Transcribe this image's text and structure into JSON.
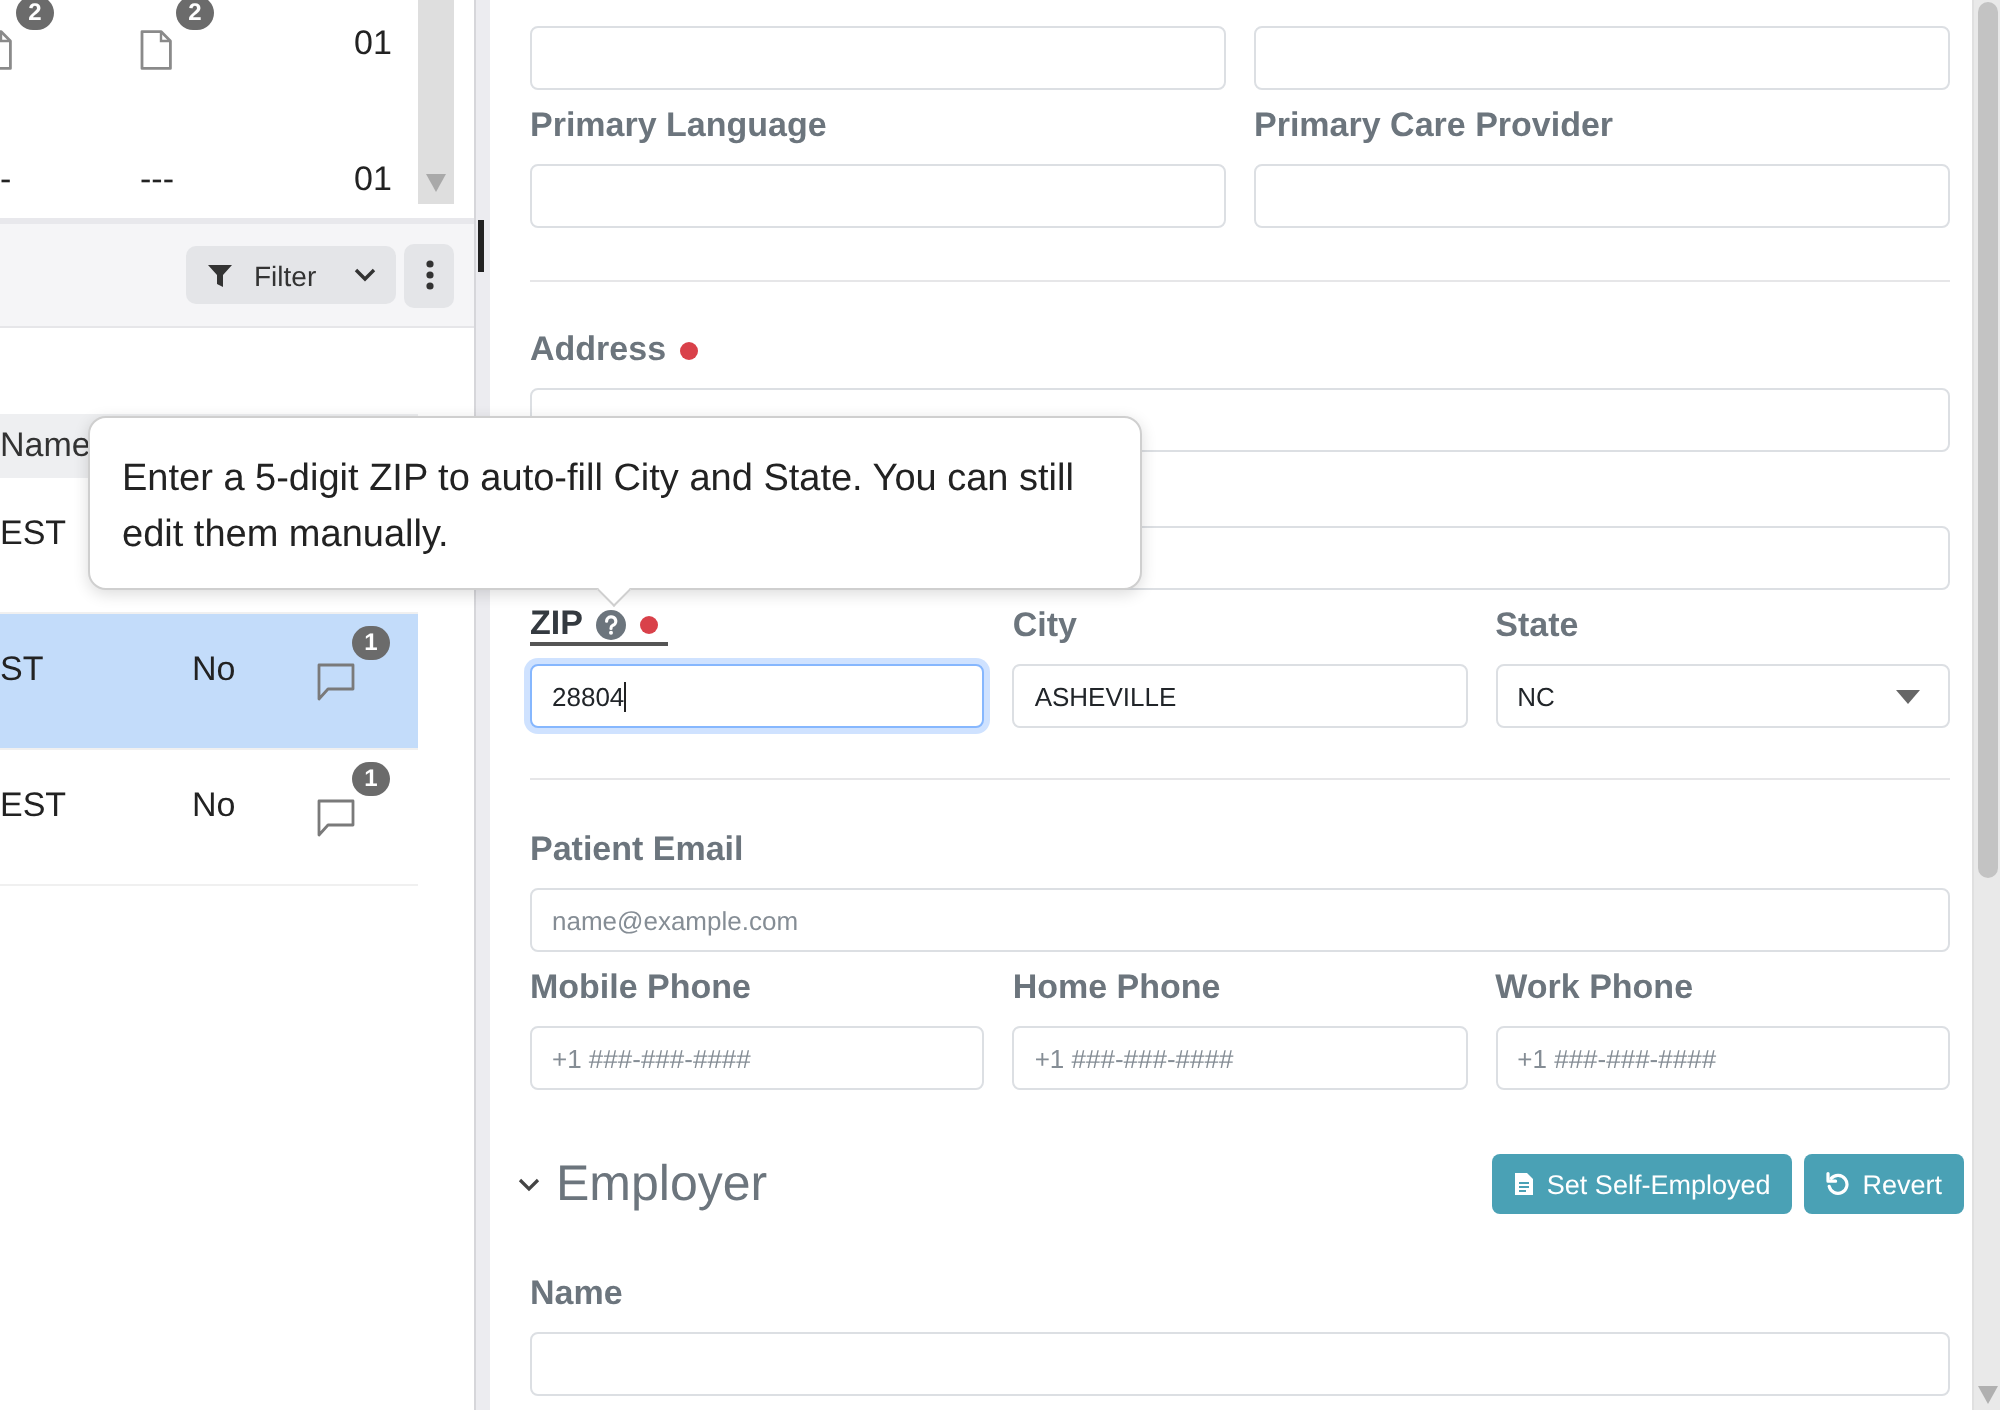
{
  "left_panel": {
    "top_table": {
      "rows": [
        {
          "cells": [
            {
              "kind": "docedge",
              "badge": "2"
            },
            {
              "kind": "document",
              "badge": "2"
            },
            {
              "kind": "text",
              "text": "01"
            }
          ]
        },
        {
          "cells": [
            {
              "kind": "text",
              "text": "-"
            },
            {
              "kind": "text",
              "text": "---"
            },
            {
              "kind": "text",
              "text": "01"
            }
          ]
        }
      ]
    },
    "toolbar": {
      "filter_button": {
        "label": "Filter"
      }
    },
    "table": {
      "columns": [
        "Name"
      ],
      "rows": [
        {
          "selected": false,
          "cells": [
            {
              "kind": "text",
              "text": "EST"
            }
          ]
        },
        {
          "selected": true,
          "cells": [
            {
              "kind": "text",
              "text": "ST"
            },
            {
              "kind": "text",
              "text": "No"
            },
            {
              "kind": "comment",
              "badge": "1"
            }
          ]
        },
        {
          "selected": false,
          "cells": [
            {
              "kind": "text",
              "text": "EST"
            },
            {
              "kind": "text",
              "text": "No"
            },
            {
              "kind": "comment",
              "badge": "1"
            }
          ]
        }
      ]
    }
  },
  "form": {
    "groups": [
      {
        "rows": [
          {
            "fields": [
              {
                "kind": "text",
                "focused": false
              },
              {
                "kind": "text",
                "focused": false
              }
            ]
          },
          {
            "fields": [
              {
                "label": "Primary Language",
                "kind": "text",
                "required": false,
                "help": false,
                "focused": false
              },
              {
                "label": "Primary Care Provider",
                "kind": "text",
                "required": false,
                "help": false,
                "focused": false
              }
            ]
          }
        ]
      },
      {
        "rows": [
          {
            "fields": [
              {
                "label": "Address",
                "kind": "text",
                "required": true,
                "help": false,
                "focused": false
              }
            ]
          },
          {
            "fields": [
              {
                "kind": "text",
                "required": false,
                "help": false,
                "focused": false
              }
            ]
          },
          {
            "fields": [
              {
                "label": "ZIP",
                "kind": "text",
                "required": true,
                "help": true,
                "focused": true,
                "value": "28804"
              },
              {
                "label": "City",
                "kind": "text",
                "required": false,
                "help": false,
                "focused": false,
                "value": "ASHEVILLE"
              },
              {
                "label": "State",
                "kind": "select",
                "required": false,
                "help": false,
                "focused": false,
                "value": "NC"
              }
            ]
          }
        ]
      },
      {
        "rows": [
          {
            "fields": [
              {
                "label": "Patient Email",
                "kind": "text",
                "required": false,
                "help": false,
                "focused": false,
                "placeholder": "name@example.com"
              }
            ]
          },
          {
            "fields": [
              {
                "label": "Mobile Phone",
                "kind": "text",
                "required": false,
                "help": false,
                "focused": false,
                "placeholder": "+1 ###-###-####"
              },
              {
                "label": "Home Phone",
                "kind": "text",
                "required": false,
                "help": false,
                "focused": false,
                "placeholder": "+1 ###-###-####"
              },
              {
                "label": "Work Phone",
                "kind": "text",
                "required": false,
                "help": false,
                "focused": false,
                "placeholder": "+1 ###-###-####"
              }
            ]
          }
        ]
      }
    ]
  },
  "employer": {
    "title": "Employer",
    "expanded": true,
    "buttons": [
      {
        "label": "Set Self-Employed",
        "kind": "document"
      },
      {
        "label": "Revert",
        "kind": "undo"
      }
    ],
    "rows": [
      {
        "fields": [
          {
            "label": "Name",
            "kind": "text",
            "required": false,
            "help": false,
            "focused": false
          }
        ]
      }
    ]
  },
  "tooltip": {
    "text": "Enter a 5-digit ZIP to auto-fill City and State. You can still edit them manually."
  }
}
